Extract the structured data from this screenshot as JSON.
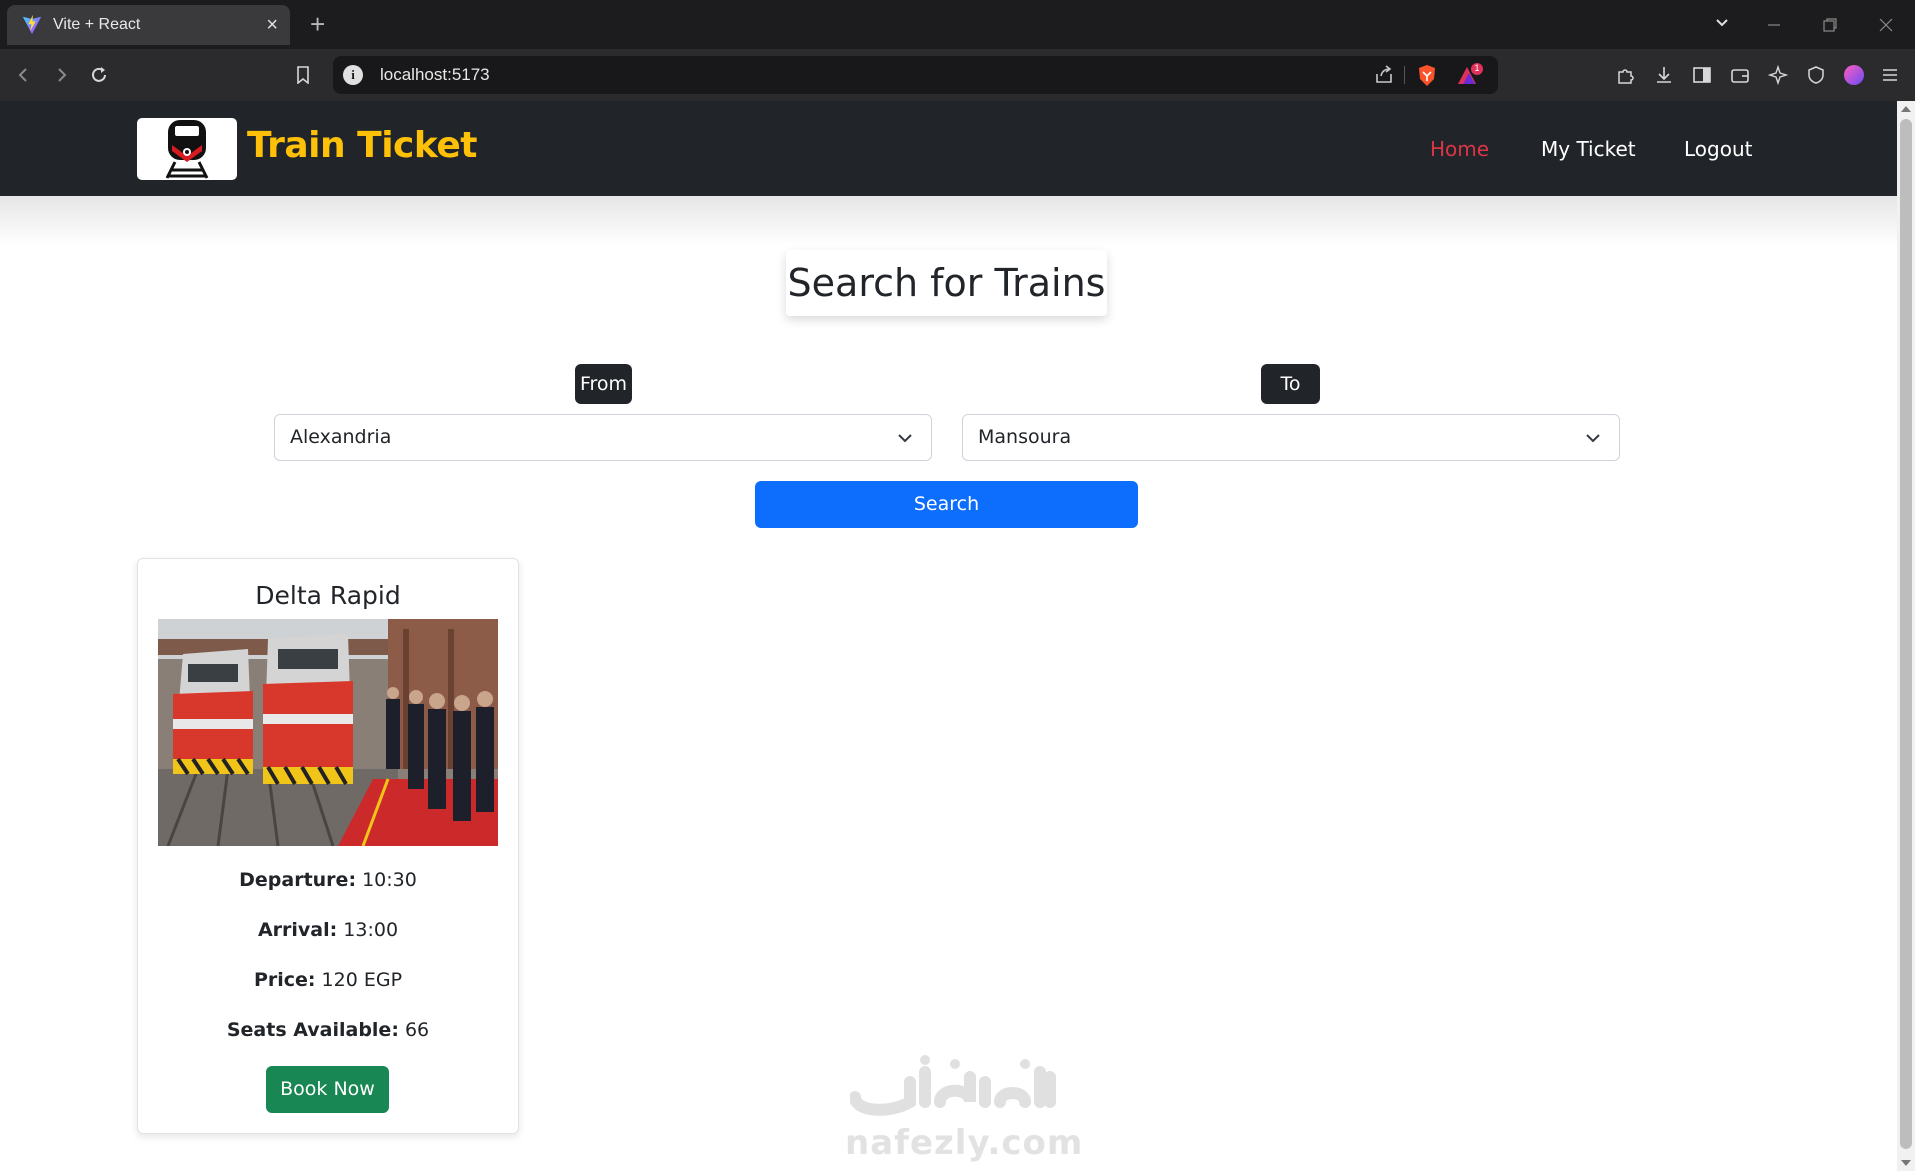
{
  "browser": {
    "tab_title": "Vite + React",
    "tab_close": "×",
    "new_tab": "+",
    "url": "localhost:5173",
    "brave_badge_count": "1"
  },
  "navbar": {
    "brand": "Train Ticket",
    "links": [
      "Home",
      "My Ticket",
      "Logout"
    ]
  },
  "search": {
    "title": "Search for Trains",
    "from_label": "From",
    "to_label": "To",
    "from_value": "Alexandria",
    "to_value": "Mansoura",
    "button": "Search"
  },
  "results": [
    {
      "name": "Delta Rapid",
      "departure_label": "Departure:",
      "departure": "10:30",
      "arrival_label": "Arrival:",
      "arrival": "13:00",
      "price_label": "Price:",
      "price": "120 EGP",
      "seats_label": "Seats Available:",
      "seats": "66",
      "button": "Book Now"
    }
  ],
  "watermark": "nafezly.com",
  "colors": {
    "navbar_bg": "#212529",
    "brand": "#ffc107",
    "active_link": "#dc3545",
    "primary": "#0d6efd",
    "success": "#198754"
  }
}
